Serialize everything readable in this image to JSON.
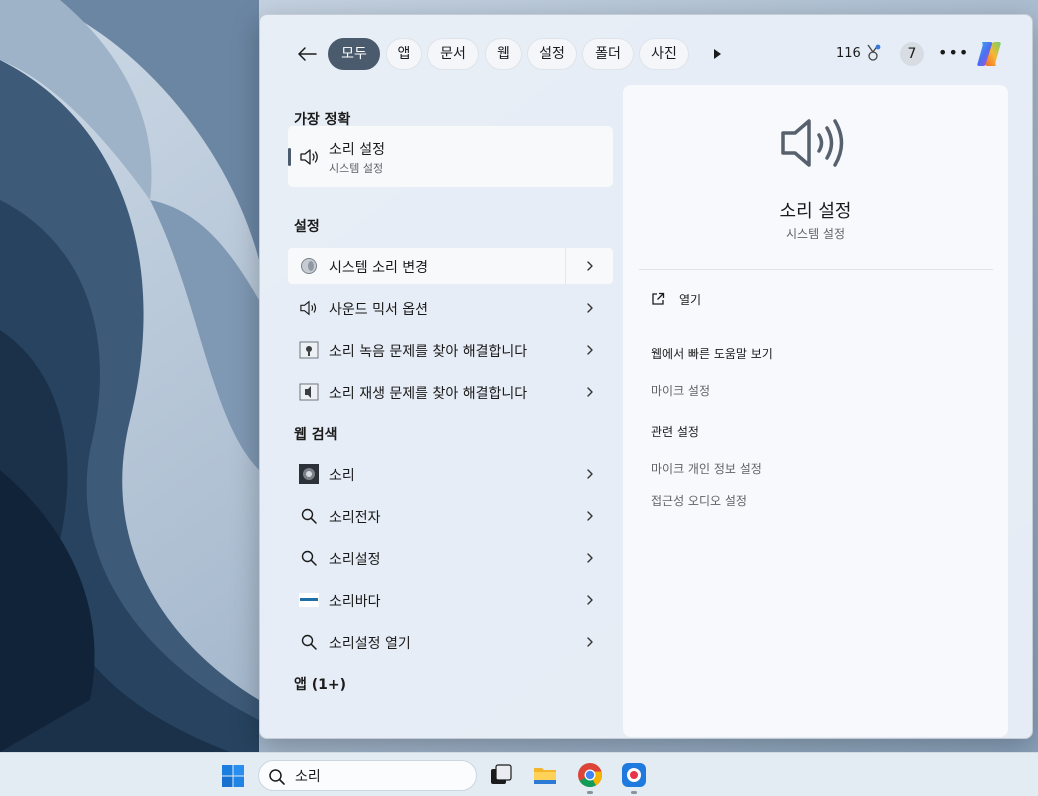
{
  "filters": {
    "back_icon": "back-arrow-icon",
    "items": [
      {
        "label": "모두",
        "active": true
      },
      {
        "label": "앱"
      },
      {
        "label": "문서"
      },
      {
        "label": "웹"
      },
      {
        "label": "설정"
      },
      {
        "label": "폴더"
      },
      {
        "label": "사진"
      }
    ],
    "more_filters_icon": "play-icon",
    "rewards_points": "116",
    "notification_count": "7",
    "more_icon": "more-icon"
  },
  "results": {
    "best_match": {
      "heading": "가장 정확",
      "title": "소리 설정",
      "subtitle": "시스템 설정",
      "icon": "speaker-icon"
    },
    "settings": {
      "heading": "설정",
      "items": [
        {
          "label": "시스템 소리 변경",
          "icon": "system-sound-icon"
        },
        {
          "label": "사운드 믹서 옵션",
          "icon": "speaker-icon"
        },
        {
          "label": "소리 녹음 문제를 찾아 해결합니다",
          "icon": "troubleshoot-icon"
        },
        {
          "label": "소리 재생 문제를 찾아 해결합니다",
          "icon": "troubleshoot-icon"
        }
      ]
    },
    "web": {
      "heading": "웹 검색",
      "items": [
        {
          "label": "소리",
          "icon": "web-thumbnail-icon"
        },
        {
          "label": "소리전자",
          "icon": "search-icon"
        },
        {
          "label": "소리설정",
          "icon": "search-icon"
        },
        {
          "label": "소리바다",
          "icon": "site-logo-icon"
        },
        {
          "label": "소리설정 열기",
          "icon": "search-icon"
        }
      ]
    },
    "apps": {
      "heading": "앱 (1+)"
    }
  },
  "detail": {
    "title": "소리 설정",
    "subtitle": "시스템 설정",
    "open_label": "열기",
    "web_help_heading": "웹에서 빠른 도움말 보기",
    "web_help_items": [
      "마이크 설정"
    ],
    "related_heading": "관련 설정",
    "related_items": [
      "마이크 개인 정보 설정",
      "접근성 오디오 설정"
    ]
  },
  "taskbar": {
    "search_value": "소리",
    "apps": [
      "start-icon",
      "task-view-icon",
      "file-explorer-icon",
      "chrome-icon",
      "recorder-icon"
    ]
  },
  "colors": {
    "active_pill": "#4a5b6e",
    "panel_bg": "#e8eef7",
    "detail_bg": "#f7f9fc"
  }
}
